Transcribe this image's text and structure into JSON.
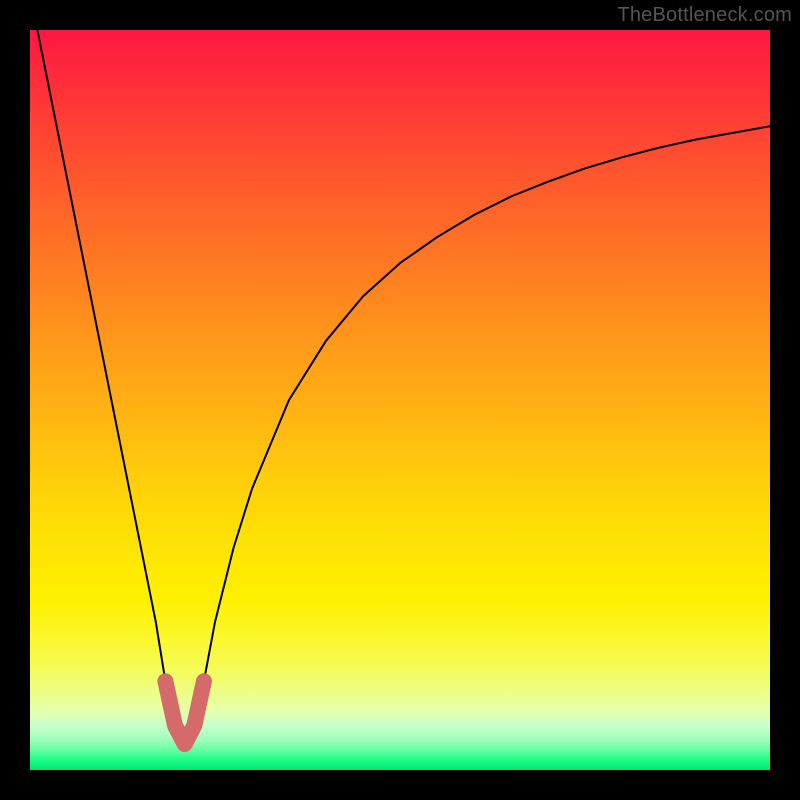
{
  "watermark": "TheBottleneck.com",
  "colors": {
    "frame": "#000000",
    "curve": "#000000",
    "accent_dots": "#d46a6a",
    "gradient_top": "#ff1744",
    "gradient_bottom": "#00e676"
  },
  "chart_data": {
    "type": "line",
    "title": "",
    "xlabel": "",
    "ylabel": "",
    "xlim": [
      0,
      100
    ],
    "ylim": [
      0,
      100
    ],
    "grid": false,
    "legend": false,
    "annotations": [
      {
        "text": "TheBottleneck.com",
        "position": "top-right"
      }
    ],
    "note": "Axes carry no numeric tick labels in the source image; values below are read off by treating the plotting area as 0–100 in each direction, bottom-left origin. The curve is a V-shaped bottleneck profile with its minimum near x≈21.",
    "series": [
      {
        "name": "bottleneck-curve",
        "x": [
          1,
          3,
          5,
          7,
          9,
          11,
          13,
          15,
          17,
          18.3,
          19.6,
          20.9,
          22.2,
          23.5,
          25,
          27.5,
          30,
          35,
          40,
          45,
          50,
          55,
          60,
          65,
          70,
          75,
          80,
          85,
          90,
          95,
          100
        ],
        "y": [
          100,
          90,
          80,
          70,
          60,
          50,
          40,
          30,
          20,
          12,
          6,
          3.5,
          6,
          12,
          20,
          30,
          38,
          50,
          58,
          64,
          68.5,
          72,
          75,
          77.5,
          79.5,
          81.3,
          82.8,
          84.1,
          85.2,
          86.1,
          87
        ]
      },
      {
        "name": "sweet-spot-marker",
        "x": [
          18.3,
          19.6,
          20.9,
          22.2,
          23.5
        ],
        "y": [
          12,
          6,
          3.5,
          6,
          12
        ]
      }
    ]
  }
}
